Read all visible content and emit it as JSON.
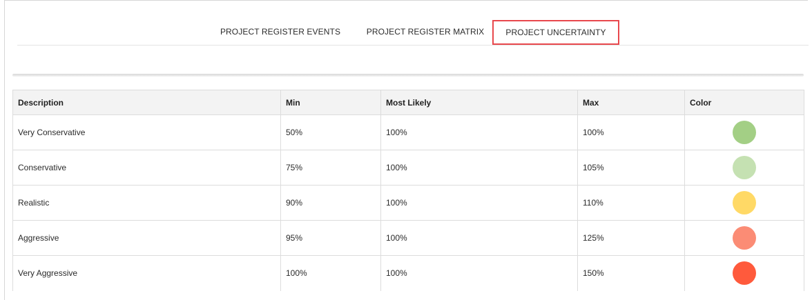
{
  "tabs": [
    {
      "label": "PROJECT REGISTER EVENTS"
    },
    {
      "label": "PROJECT REGISTER MATRIX"
    },
    {
      "label": "PROJECT UNCERTAINTY"
    }
  ],
  "table": {
    "headers": {
      "description": "Description",
      "min": "Min",
      "most_likely": "Most Likely",
      "max": "Max",
      "color": "Color"
    },
    "rows": [
      {
        "description": "Very Conservative",
        "min": "50%",
        "most_likely": "100%",
        "max": "100%",
        "color": "#a3cf85"
      },
      {
        "description": "Conservative",
        "min": "75%",
        "most_likely": "100%",
        "max": "105%",
        "color": "#c5e1b2"
      },
      {
        "description": "Realistic",
        "min": "90%",
        "most_likely": "100%",
        "max": "110%",
        "color": "#ffd966"
      },
      {
        "description": "Aggressive",
        "min": "95%",
        "most_likely": "100%",
        "max": "125%",
        "color": "#fb8c75"
      },
      {
        "description": "Very Aggressive",
        "min": "100%",
        "most_likely": "100%",
        "max": "150%",
        "color": "#ff5a3c"
      }
    ]
  }
}
